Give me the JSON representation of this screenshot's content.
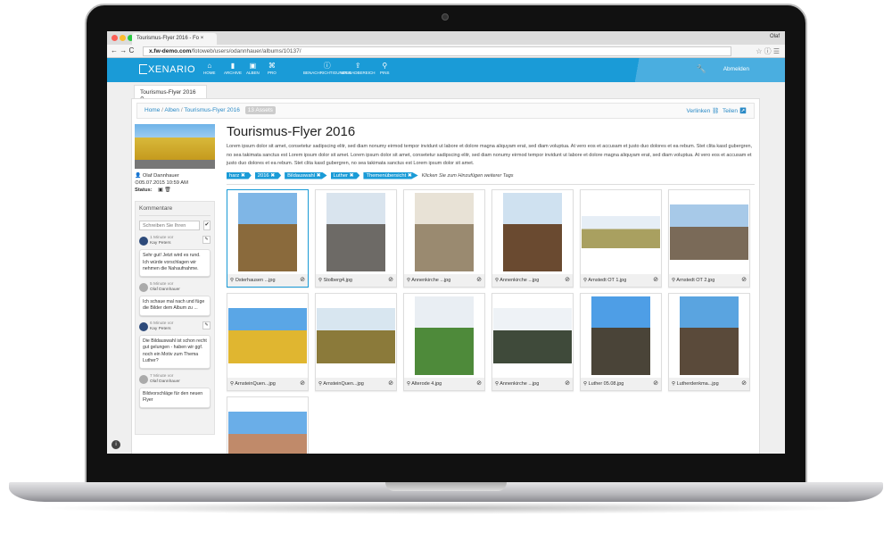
{
  "browser": {
    "tab_title": "Tourismus-Flyer 2016 - Fo",
    "user": "Olaf",
    "url_host": "x.fw-demo.com",
    "url_path": "/fotoweb/users/odannhauer/albums/10137/"
  },
  "nav": {
    "logo": "XENARIO",
    "items": [
      {
        "label": "HOME",
        "icon": "⌂"
      },
      {
        "label": "ARCHIVE",
        "icon": "▮"
      },
      {
        "label": "ALBEN",
        "icon": "▣"
      },
      {
        "label": "PRO",
        "icon": "⌘"
      },
      {
        "label": "BENACHRICHTIGUNGEN",
        "icon": "ⓘ"
      },
      {
        "label": "UPLOADBEREICH",
        "icon": "⇪"
      },
      {
        "label": "PINS",
        "icon": "⚲"
      }
    ],
    "logout": "Abmelden",
    "wrench": "🔧"
  },
  "page_tab": "Tourismus-Flyer 2016 ⚲",
  "breadcrumb": {
    "home": "Home",
    "albums": "Alben",
    "current": "Tourismus-Flyer 2016",
    "count": "13 Assets",
    "link": "Verlinken ⛓",
    "share": "Teilen ↗"
  },
  "meta": {
    "owner": "Olaf Dannhauer",
    "date": "05.07.2015 10:59 AM",
    "status_label": "Status:"
  },
  "comments": {
    "title": "Kommentare",
    "placeholder": "Schreiben Sie Ihren",
    "items": [
      {
        "time": "1 Minute vor",
        "author": "Kay Peters",
        "text": "Sehr gut! Jetzt wird es rund. Ich würde vorschlagen wir nehmen die Nahaufnahme.",
        "editable": true,
        "avatar": "#2d4a7a"
      },
      {
        "time": "5 Minute vor",
        "author": "Olaf Dannhauer",
        "text": "Ich schaue mal nach und füge die Bilder dem Album zu ...",
        "editable": false,
        "avatar": "#aaaaaa"
      },
      {
        "time": "6 Minute vor",
        "author": "Kay Peters",
        "text": "Die Bildauswahl ist schon recht gut gelungen - haben wir ggf. noch ein Motiv zum Thema Luther?",
        "editable": true,
        "avatar": "#2d4a7a"
      },
      {
        "time": "7 Minute vor",
        "author": "Olaf Dannhauer",
        "text": "Bildvorschläge für den neuen Flyer",
        "editable": false,
        "avatar": "#aaaaaa"
      }
    ]
  },
  "album": {
    "title": "Tourismus-Flyer 2016",
    "description": "Lorem ipsum dolor sit amet, consetetur sadipscing elitr, sed diam nonumy eirmod tempor invidunt ut labore et dolore magna aliquyam erat, sed diam voluptua. At vero eos et accusam et justo duo dolores et ea rebum. Stet clita kasd gubergren, no sea takimata sanctus est Lorem ipsum dolor sit amet. Lorem ipsum dolor sit amet, consetetur sadipscing elitr, sed diam nonumy eirmod tempor invidunt ut labore et dolore magna aliquyam erat, sed diam voluptua. At vero eos et accusam et justo duo dolores et ea rebum. Stet clita kasd gubergren, no sea takimata sanctus est Lorem ipsum dolor sit amet.",
    "tags": [
      "harz ✖",
      "2016 ✖",
      "Bildauswahl ✖",
      "Luther ✖",
      "Themenübersicht ✖"
    ],
    "tag_hint": "Klicken Sie zum Hinzufügen weiterer Tags"
  },
  "assets": [
    {
      "name": "Osterhausen ...jpg",
      "top": "#7fb6e6",
      "bottom": "#8a6a3c",
      "portrait": true,
      "selected": true
    },
    {
      "name": "Stolberg4.jpg",
      "top": "#d9e4ee",
      "bottom": "#6d6a66",
      "portrait": true
    },
    {
      "name": "Annenkirche ...jpg",
      "top": "#e8e2d6",
      "bottom": "#9a8a70",
      "portrait": true
    },
    {
      "name": "Annenkirche ...jpg",
      "top": "#cfe1f0",
      "bottom": "#6a4a30",
      "portrait": true
    },
    {
      "name": "Arnstedt OT 1.jpg",
      "top": "#e6eef6",
      "bottom": "#a9a060",
      "portrait": false
    },
    {
      "name": "Arnstedt OT 2.jpg",
      "top": "#a7c9e8",
      "bottom": "#7a6a58",
      "portrait": false
    },
    {
      "name": "ArnsteinQuen...jpg",
      "top": "#5aa6e6",
      "bottom": "#e0b630",
      "portrait": false
    },
    {
      "name": "ArnsteinQuen...jpg",
      "top": "#d8e6f0",
      "bottom": "#8b7a3a",
      "portrait": false
    },
    {
      "name": "Alterode 4.jpg",
      "top": "#e9eef3",
      "bottom": "#4e8a3a",
      "portrait": true
    },
    {
      "name": "Annenkirche ...jpg",
      "top": "#eef2f6",
      "bottom": "#3f4a3a",
      "portrait": false
    },
    {
      "name": "Luther 05.08.jpg",
      "top": "#4e9ee6",
      "bottom": "#4a4438",
      "portrait": true
    },
    {
      "name": "Lutherdenkma...jpg",
      "top": "#5aa4e0",
      "bottom": "#5a4a3a",
      "portrait": true
    },
    {
      "name": "",
      "top": "#6aaee8",
      "bottom": "#c08a6a",
      "portrait": false
    }
  ]
}
